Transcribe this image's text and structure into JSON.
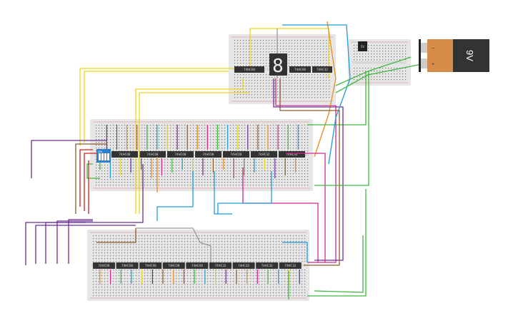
{
  "battery": {
    "label": "9V",
    "minus": "−",
    "plus": "+"
  },
  "regulator": {
    "label": "5V"
  },
  "top_board": {
    "chips": [
      "74HC08",
      "74HC08",
      "74HC32"
    ],
    "display": "8"
  },
  "middle_board": {
    "switch_label": "ON",
    "chips": [
      "74HC08",
      "74HC08",
      "74HC08",
      "74HC08",
      "74HC08",
      "74HC32",
      "74HC32"
    ]
  },
  "bottom_board": {
    "chips": [
      "74HC08",
      "74HC08",
      "74HC08",
      "74HC08",
      "74HC08",
      "74HC32",
      "74HC32",
      "74HC32",
      "74HC32"
    ]
  },
  "colors": {
    "breadboard": "#e6e6e6",
    "chip": "#333333",
    "battery_body": "#d88c4a",
    "wire_green": "#3db83d",
    "wire_yellow": "#f2d21b",
    "wire_purple": "#6b2d8f",
    "wire_magenta": "#d4268f",
    "wire_blue": "#1e9bd7",
    "wire_orange": "#f08a1c",
    "wire_brown": "#8b5a2b",
    "wire_gray": "#999999",
    "wire_red": "#d02020"
  }
}
